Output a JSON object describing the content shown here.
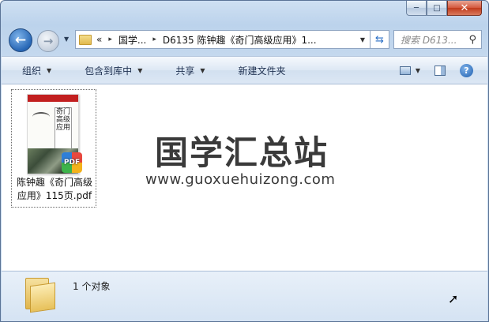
{
  "window": {
    "caption": {
      "minimize": "─",
      "maximize": "□",
      "close": "✕"
    }
  },
  "nav": {
    "back_icon": "arrow-left-icon",
    "forward_icon": "arrow-right-icon"
  },
  "address": {
    "lead": "«",
    "crumbs": [
      "国学...",
      "D6135 陈钟趣《奇门高级应用》1..."
    ],
    "separator": "▸"
  },
  "search": {
    "placeholder": "搜索 D613..."
  },
  "toolbar": {
    "items": [
      {
        "label": "组织"
      },
      {
        "label": "包含到库中"
      },
      {
        "label": "共享"
      },
      {
        "label": "新建文件夹"
      }
    ],
    "help": "?"
  },
  "files": [
    {
      "name": "陈钟趣《奇门高级应用》115页.pdf",
      "name_line1": "陈钟趣《奇门高级",
      "name_line2": "应用》115页.pdf",
      "thumb_title": "奇门高级应用",
      "badge": "PDF"
    }
  ],
  "watermark": {
    "title": "国学汇总站",
    "url": "www.guoxuehuizong.com"
  },
  "details": {
    "count_text": "1 个对象"
  },
  "colors": {
    "chrome": "#c6d9ee",
    "toolbar": "#dce7f4",
    "close": "#c13b1c"
  }
}
